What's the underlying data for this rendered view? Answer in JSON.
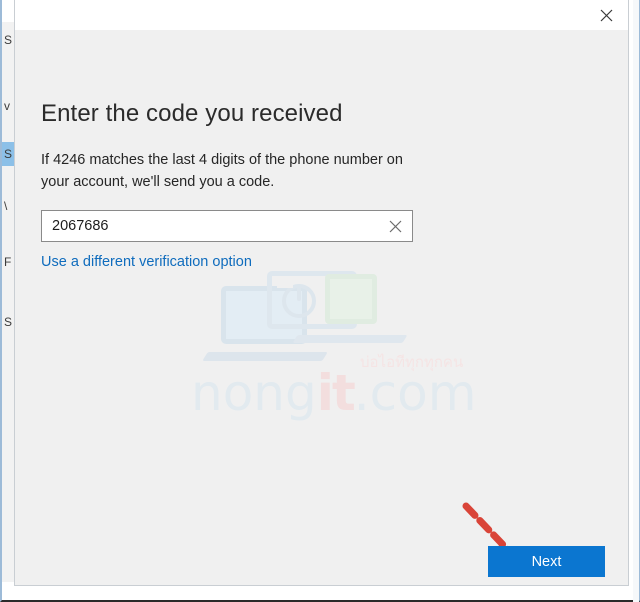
{
  "background_window": {
    "nav_fragments": [
      {
        "label": "S",
        "selected": false
      },
      {
        "label": "v",
        "selected": false
      },
      {
        "label": "S",
        "selected": true
      },
      {
        "label": "\\",
        "selected": false
      },
      {
        "label": "F",
        "selected": false
      },
      {
        "label": "S",
        "selected": false
      }
    ]
  },
  "dialog": {
    "close_icon": "close-icon",
    "heading": "Enter the code you received",
    "body_text": "If 4246 matches the last 4 digits of the phone number on your account, we'll send you a code.",
    "code_field": {
      "value": "2067686",
      "placeholder": "",
      "clear_icon": "clear-icon"
    },
    "alt_option_link": "Use a different verification option",
    "next_button": "Next"
  },
  "watermark": {
    "brand_part1": "nong",
    "brand_part2": "it",
    "brand_part3": ".com",
    "thai_tagline": "บ่อไอทีทุกทุกคน"
  },
  "colors": {
    "accent_blue": "#0b76d0",
    "link_blue": "#0f6cbd",
    "dialog_bg": "#f0f0f0",
    "titlebar_bg": "#ffffff",
    "annotation_red": "#d94438",
    "watermark_blue": "#e2eaef",
    "watermark_red": "#f3dede"
  }
}
